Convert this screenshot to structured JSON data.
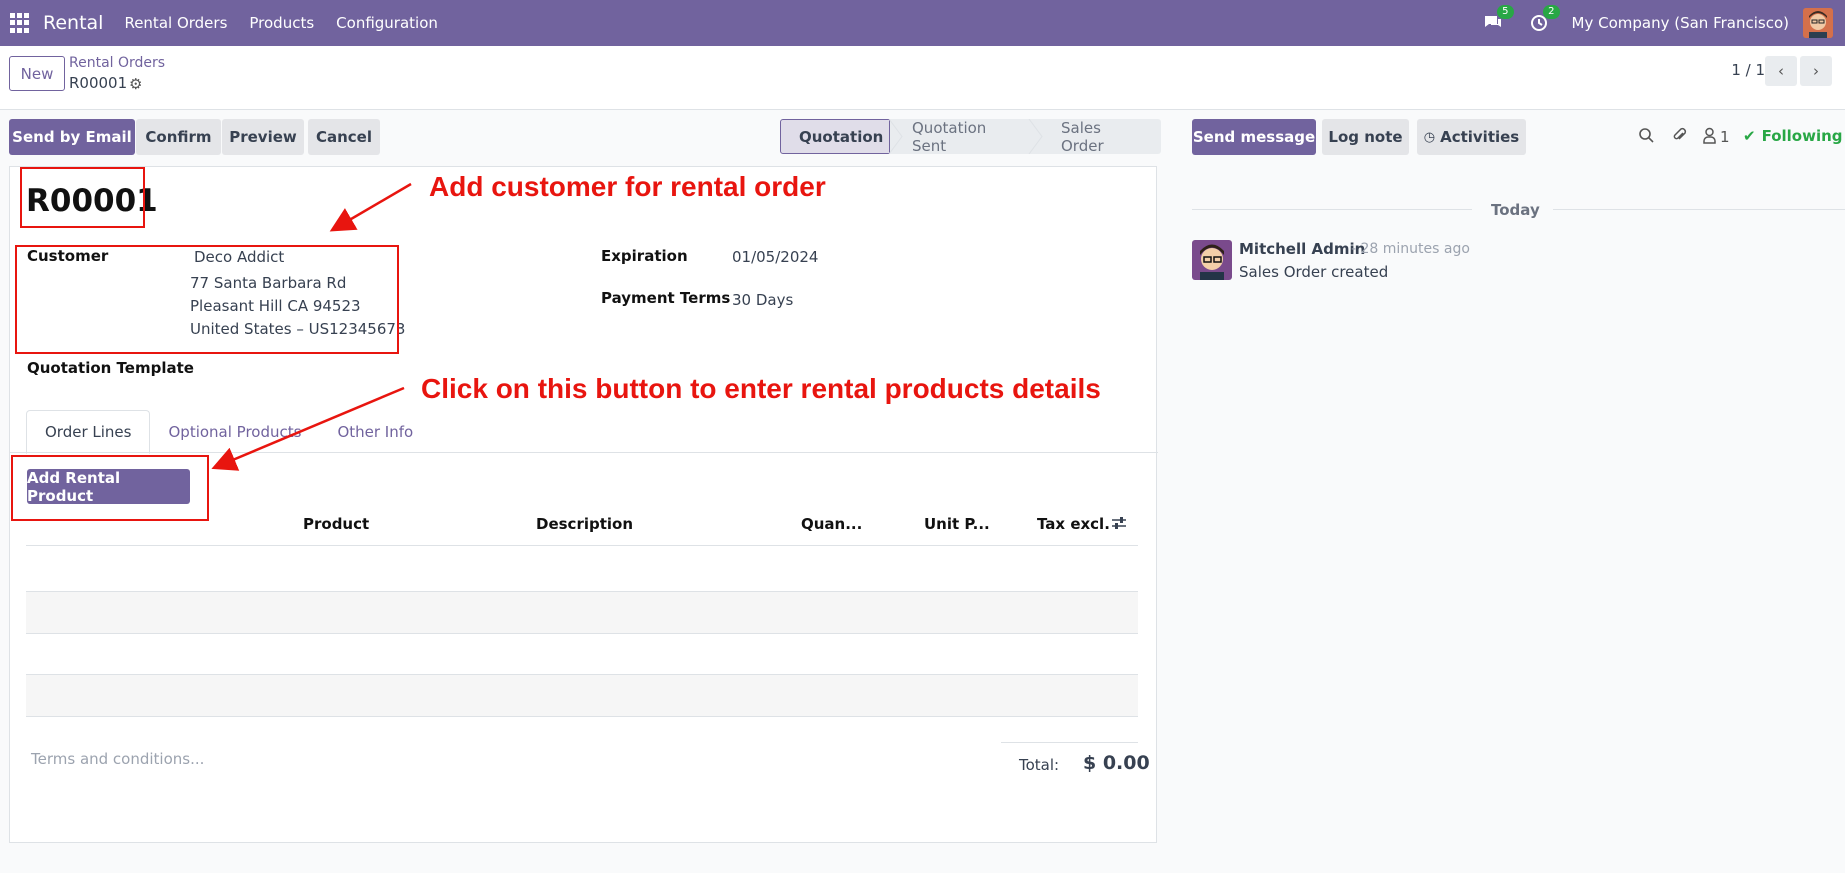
{
  "navbar": {
    "app_name": "Rental",
    "menu": [
      "Rental Orders",
      "Products",
      "Configuration"
    ],
    "messages_count": "5",
    "activities_count": "2",
    "company": "My Company (San Francisco)"
  },
  "control_panel": {
    "new_label": "New",
    "breadcrumb_parent": "Rental Orders",
    "breadcrumb_current": "R00001",
    "pager": "1 / 1"
  },
  "actions": {
    "send_email": "Send by Email",
    "confirm": "Confirm",
    "preview": "Preview",
    "cancel": "Cancel"
  },
  "statusbar": [
    "Quotation",
    "Quotation Sent",
    "Sales Order"
  ],
  "form": {
    "order_name": "R00001",
    "customer_label": "Customer",
    "customer_name": "Deco Addict",
    "address_line1": "77 Santa Barbara Rd",
    "address_line2": "Pleasant Hill CA 94523",
    "address_line3": "United States – US12345673",
    "expiration_label": "Expiration",
    "expiration_value": "01/05/2024",
    "payment_terms_label": "Payment Terms",
    "payment_terms_value": "30 Days",
    "quotation_template_label": "Quotation Template",
    "tabs": [
      "Order Lines",
      "Optional Products",
      "Other Info"
    ],
    "add_rental_product": "Add Rental Product",
    "columns": [
      "Product",
      "Description",
      "Quan...",
      "Unit P...",
      "Tax excl."
    ],
    "terms_placeholder": "Terms and conditions...",
    "total_label": "Total:",
    "total_value": "$ 0.00"
  },
  "chatter": {
    "send_message": "Send message",
    "log_note": "Log note",
    "activities": "Activities",
    "followers_count": "1",
    "following": "Following",
    "date_separator": "Today",
    "author": "Mitchell Admin",
    "time": "- 28 minutes ago",
    "body": "Sales Order created"
  },
  "annotations": {
    "customer_note": "Add customer for rental order",
    "button_note": "Click on this button to enter rental products details"
  }
}
